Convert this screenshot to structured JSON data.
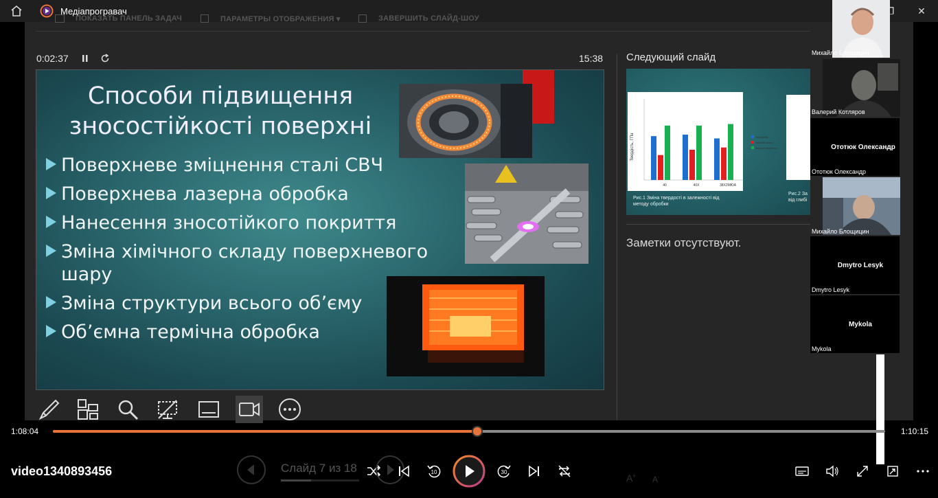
{
  "window": {
    "title": "Медіапрогравач"
  },
  "presenter_toolbar": {
    "taskbar": "ПОКАЗАТЬ ПАНЕЛЬ ЗАДАЧ",
    "display": "ПАРАМЕТРЫ ОТОБРАЖЕНИЯ ▾",
    "end": "ЗАВЕРШИТЬ СЛАЙД-ШОУ"
  },
  "presenter": {
    "elapsed": "0:02:37",
    "clock": "15:38",
    "next_label": "Следующий слайд",
    "notes": "Заметки отсутствуют.",
    "slide_counter": "Слайд 7 из 18"
  },
  "slide": {
    "title": "Способи підвищення зносостійкості поверхні",
    "bullets": [
      "Поверхневе зміцнення сталі СВЧ",
      "Поверхнева лазерна обробка",
      "Нанесення зносотійкого покриття",
      "Зміна хімічного складу поверхневого шару",
      "Зміна структури всього об’єму",
      "Об’ємна термічна обробка"
    ]
  },
  "next_slide": {
    "ylabel": "Твердість, ГПа",
    "cats": [
      "40",
      "40Х",
      "38Х2МЮА"
    ],
    "legend": [
      "Гартування",
      "Хімічний вплив",
      "Лазерне зміцнення"
    ],
    "caption1": "Рис.1 Зміна твердості в залежності від методу обробки",
    "caption2": "Рис.2 За від глибі",
    "colors": [
      "#1f6fd0",
      "#e02020",
      "#18b050"
    ]
  },
  "participants": [
    {
      "name": "Михайло Блощицин"
    },
    {
      "name": "Валерий Котляров"
    },
    {
      "name": "Ототюк Олександр",
      "initials": "Ототюк Олександр"
    },
    {
      "name": "Михайло Блощицин"
    },
    {
      "name": "Dmytro Lesyk",
      "initials": "Dmytro Lesyk"
    },
    {
      "name": "Mykola",
      "initials": "Mykola"
    }
  ],
  "player": {
    "current": "1:08:04",
    "total": "1:10:15",
    "progress": 0.51,
    "filename": "video1340893456",
    "accent": "#e8743b"
  }
}
